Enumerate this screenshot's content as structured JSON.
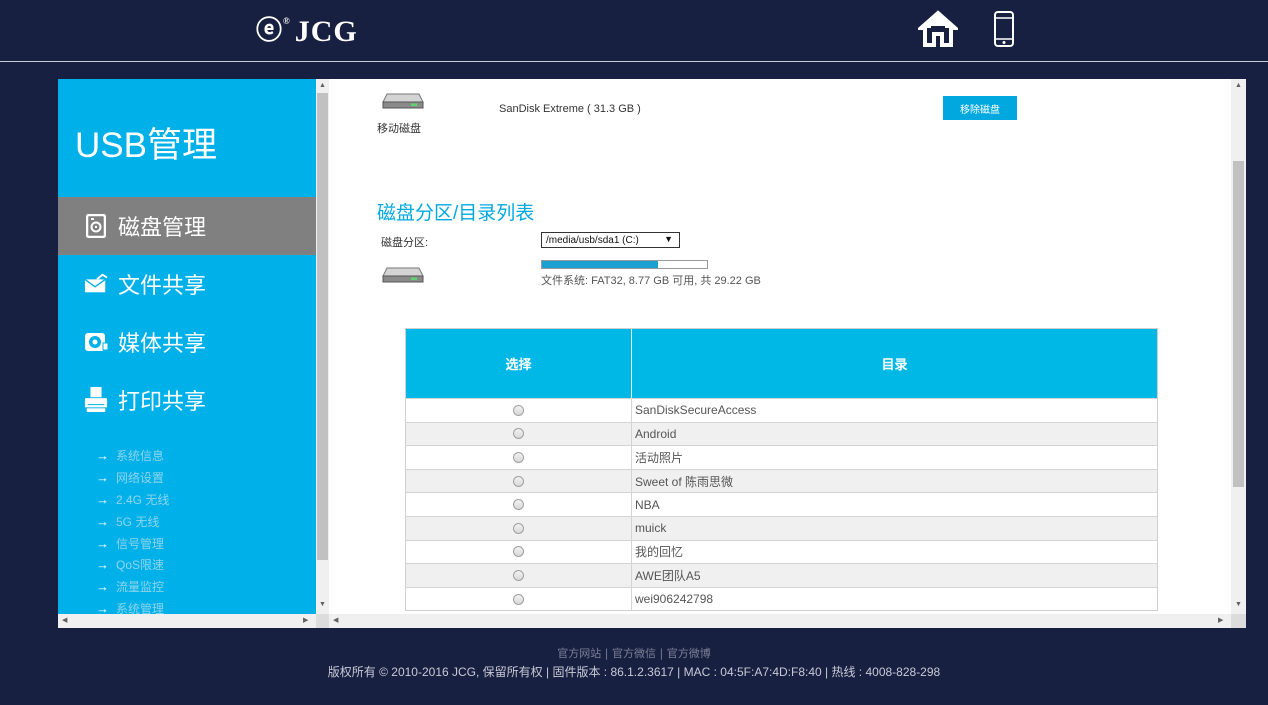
{
  "header": {
    "logo_mark": "ⓔ",
    "logo_reg": "®",
    "logo_text": "JCG"
  },
  "sidebar": {
    "title": "USB管理",
    "nav": [
      {
        "label": "磁盘管理",
        "icon": "disk-icon",
        "active": true
      },
      {
        "label": "文件共享",
        "icon": "mail-share-icon",
        "active": false
      },
      {
        "label": "媒体共享",
        "icon": "media-icon",
        "active": false
      },
      {
        "label": "打印共享",
        "icon": "printer-icon",
        "active": false
      }
    ],
    "sublinks": [
      "系统信息",
      "网络设置",
      "2.4G 无线",
      "5G 无线",
      "信号管理",
      "QoS限速",
      "流量监控",
      "系统管理"
    ],
    "arrow": "→"
  },
  "disk": {
    "label": "移动磁盘",
    "name": "SanDisk Extreme ( 31.3 GB )",
    "remove_button": "移除磁盘"
  },
  "partition": {
    "section_title": "磁盘分区/目录列表",
    "label": "磁盘分区:",
    "selected": "/media/usb/sda1 (C:)",
    "usage_fraction": 0.7,
    "fs_info": "文件系统: FAT32, 8.77 GB 可用, 共 29.22 GB"
  },
  "table": {
    "headers": [
      "选择",
      "目录"
    ],
    "rows": [
      "SanDiskSecureAccess",
      "Android",
      "活动照片",
      "Sweet of 陈雨思微",
      "NBA",
      "muick",
      "我的回忆",
      "AWE团队A5",
      "wei906242798"
    ]
  },
  "footer": {
    "links": [
      "官方网站",
      "官方微信",
      "官方微博"
    ],
    "separator": " | ",
    "copyright": "版权所有 © 2010-2016 JCG, 保留所有权 | 固件版本 : 86.1.2.3617 | MAC : 04:5F:A7:4D:F8:40 | 热线 : 4008-828-298"
  },
  "colors": {
    "background": "#172040",
    "accent": "#00b0e8",
    "active_nav": "#808080"
  }
}
